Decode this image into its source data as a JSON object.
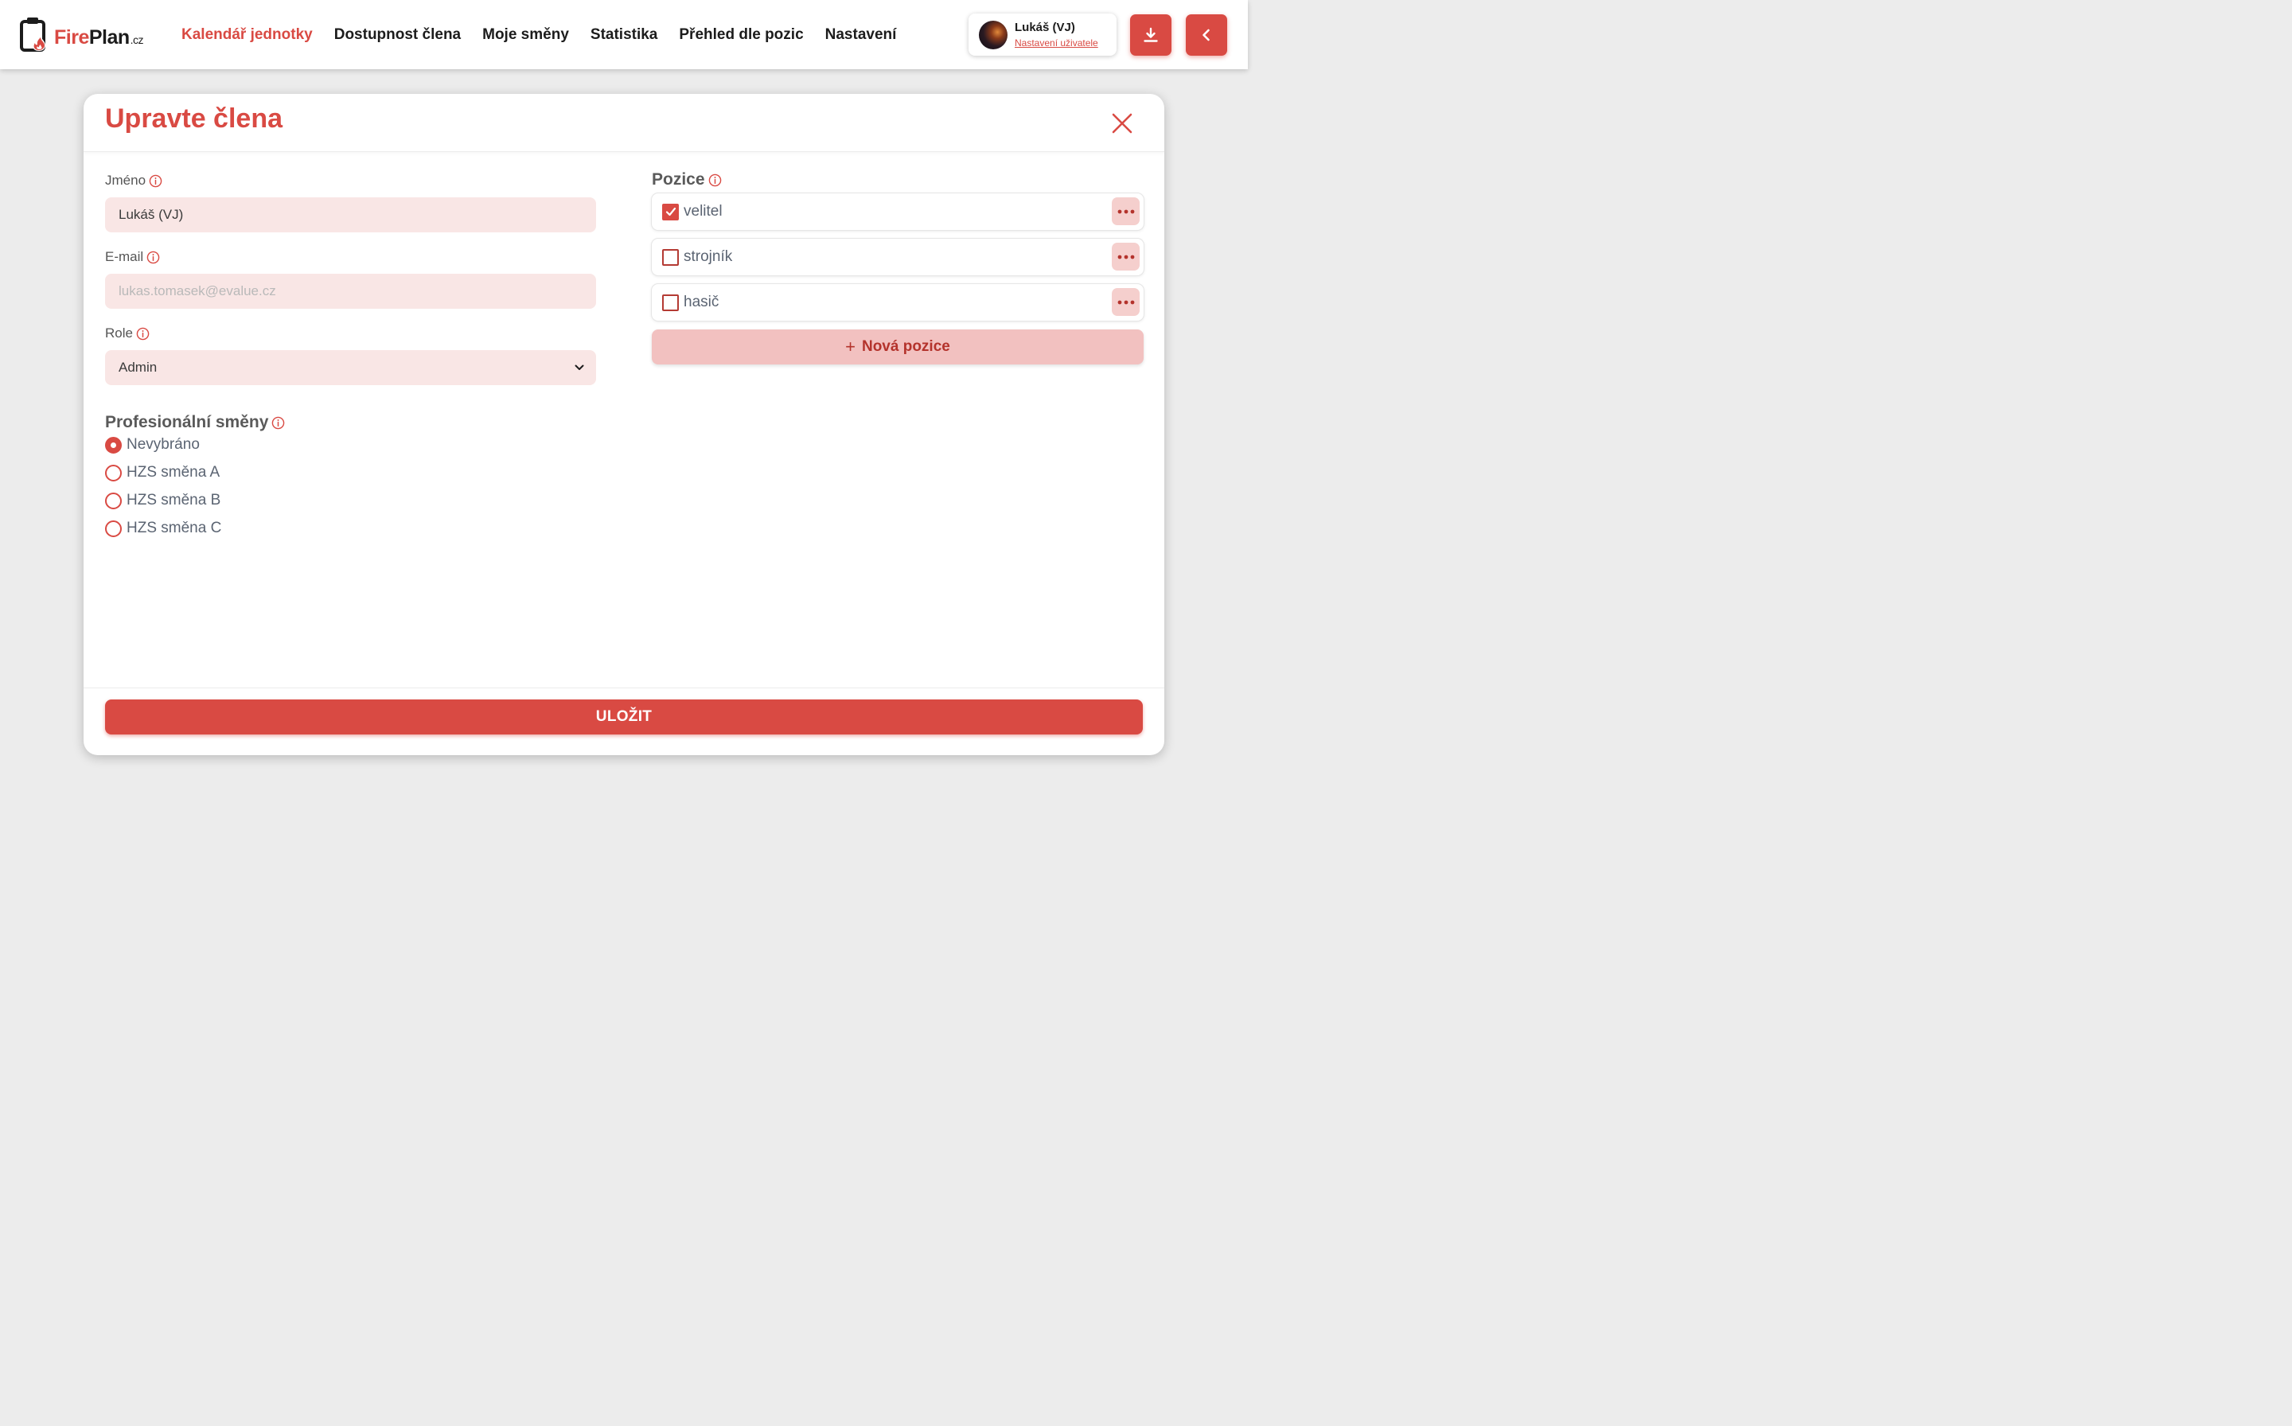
{
  "brand": {
    "name_fire": "Fire",
    "name_plan": "Plan",
    "name_tld": ".cz",
    "accent_color": "#d94a43"
  },
  "nav": {
    "items": [
      {
        "label": "Kalendář jednotky",
        "active": true
      },
      {
        "label": "Dostupnost člena",
        "active": false
      },
      {
        "label": "Moje směny",
        "active": false
      },
      {
        "label": "Statistika",
        "active": false
      },
      {
        "label": "Přehled dle pozic",
        "active": false
      },
      {
        "label": "Nastavení",
        "active": false
      }
    ]
  },
  "user": {
    "name": "Lukáš (VJ)",
    "settings_link": "Nastavení uživatele",
    "avatar_icon": "avatar-photo"
  },
  "header_buttons": {
    "download_icon": "download-icon",
    "back_icon": "chevron-left-icon"
  },
  "modal": {
    "title": "Upravte člena",
    "close_icon": "close-icon",
    "fields": {
      "name": {
        "label": "Jméno",
        "value": "Lukáš (VJ)"
      },
      "email": {
        "label": "E-mail",
        "placeholder": "lukas.tomasek@evalue.cz"
      },
      "role": {
        "label": "Role",
        "value": "Admin"
      }
    },
    "shifts": {
      "title": "Profesionální směny",
      "options": [
        {
          "label": "Nevybráno",
          "selected": true
        },
        {
          "label": "HZS směna A",
          "selected": false
        },
        {
          "label": "HZS směna B",
          "selected": false
        },
        {
          "label": "HZS směna C",
          "selected": false
        }
      ]
    },
    "positions": {
      "title": "Pozice",
      "items": [
        {
          "label": "velitel",
          "checked": true
        },
        {
          "label": "strojník",
          "checked": false
        },
        {
          "label": "hasič",
          "checked": false
        }
      ],
      "new_label": "Nová pozice"
    },
    "save_label": "ULOŽIT"
  }
}
